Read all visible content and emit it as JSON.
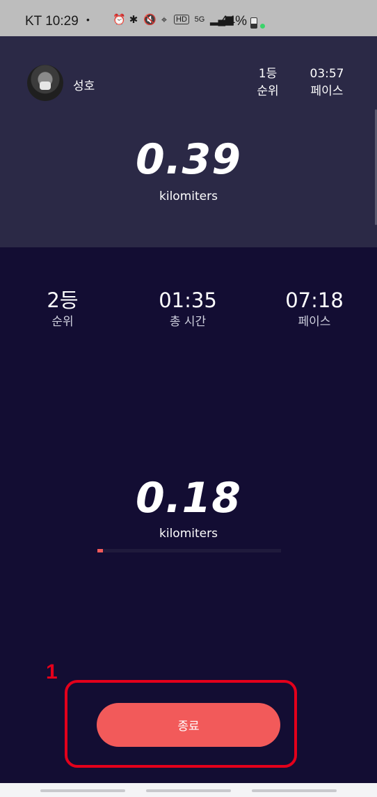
{
  "status_bar": {
    "carrier_time": "KT 10:29",
    "dot": "•",
    "icons": [
      "alarm-icon",
      "bluetooth-icon",
      "mute-icon",
      "location-icon",
      "hd-icon",
      "5g-icon",
      "signal-icon"
    ],
    "battery": "44%"
  },
  "opponent": {
    "name": "성호",
    "rank_value": "1등",
    "rank_label": "순위",
    "pace_value": "03:57",
    "pace_label": "페이스",
    "distance": "0.39",
    "unit": "kilomiters"
  },
  "me": {
    "rank_value": "2등",
    "rank_label": "순위",
    "time_value": "01:35",
    "time_label": "총 시간",
    "pace_value": "07:18",
    "pace_label": "페이스",
    "distance": "0.18",
    "unit": "kilomiters",
    "progress_fraction": 0.03
  },
  "end_button": {
    "label": "종료"
  },
  "annotation": {
    "number": "1"
  },
  "colors": {
    "accent": "#f25a5a",
    "bg": "#130d33",
    "panel": "#2b2946",
    "annotation": "#e3001b"
  }
}
